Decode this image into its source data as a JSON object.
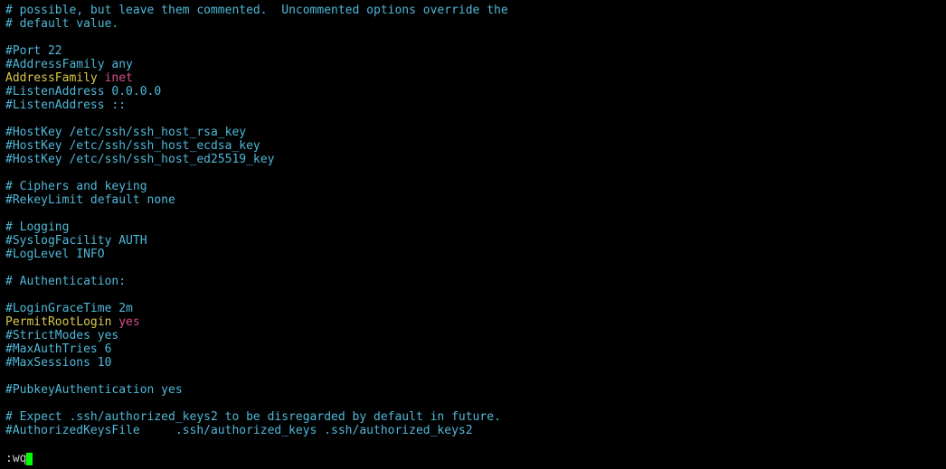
{
  "lines": [
    {
      "type": "comment",
      "text": "# possible, but leave them commented.  Uncommented options override the"
    },
    {
      "type": "comment",
      "text": "# default value."
    },
    {
      "type": "blank",
      "text": ""
    },
    {
      "type": "comment",
      "text": "#Port 22"
    },
    {
      "type": "comment",
      "text": "#AddressFamily any"
    },
    {
      "type": "kv",
      "key": "AddressFamily",
      "value": "inet"
    },
    {
      "type": "comment",
      "text": "#ListenAddress 0.0.0.0"
    },
    {
      "type": "comment",
      "text": "#ListenAddress ::"
    },
    {
      "type": "blank",
      "text": ""
    },
    {
      "type": "comment",
      "text": "#HostKey /etc/ssh/ssh_host_rsa_key"
    },
    {
      "type": "comment",
      "text": "#HostKey /etc/ssh/ssh_host_ecdsa_key"
    },
    {
      "type": "comment",
      "text": "#HostKey /etc/ssh/ssh_host_ed25519_key"
    },
    {
      "type": "blank",
      "text": ""
    },
    {
      "type": "comment",
      "text": "# Ciphers and keying"
    },
    {
      "type": "comment",
      "text": "#RekeyLimit default none"
    },
    {
      "type": "blank",
      "text": ""
    },
    {
      "type": "comment",
      "text": "# Logging"
    },
    {
      "type": "comment",
      "text": "#SyslogFacility AUTH"
    },
    {
      "type": "comment",
      "text": "#LogLevel INFO"
    },
    {
      "type": "blank",
      "text": ""
    },
    {
      "type": "comment",
      "text": "# Authentication:"
    },
    {
      "type": "blank",
      "text": ""
    },
    {
      "type": "comment",
      "text": "#LoginGraceTime 2m"
    },
    {
      "type": "kv",
      "key": "PermitRootLogin",
      "value": "yes"
    },
    {
      "type": "comment",
      "text": "#StrictModes yes"
    },
    {
      "type": "comment",
      "text": "#MaxAuthTries 6"
    },
    {
      "type": "comment",
      "text": "#MaxSessions 10"
    },
    {
      "type": "blank",
      "text": ""
    },
    {
      "type": "comment",
      "text": "#PubkeyAuthentication yes"
    },
    {
      "type": "blank",
      "text": ""
    },
    {
      "type": "comment",
      "text": "# Expect .ssh/authorized_keys2 to be disregarded by default in future."
    },
    {
      "type": "comment",
      "text": "#AuthorizedKeysFile     .ssh/authorized_keys .ssh/authorized_keys2"
    }
  ],
  "command": ":wq"
}
